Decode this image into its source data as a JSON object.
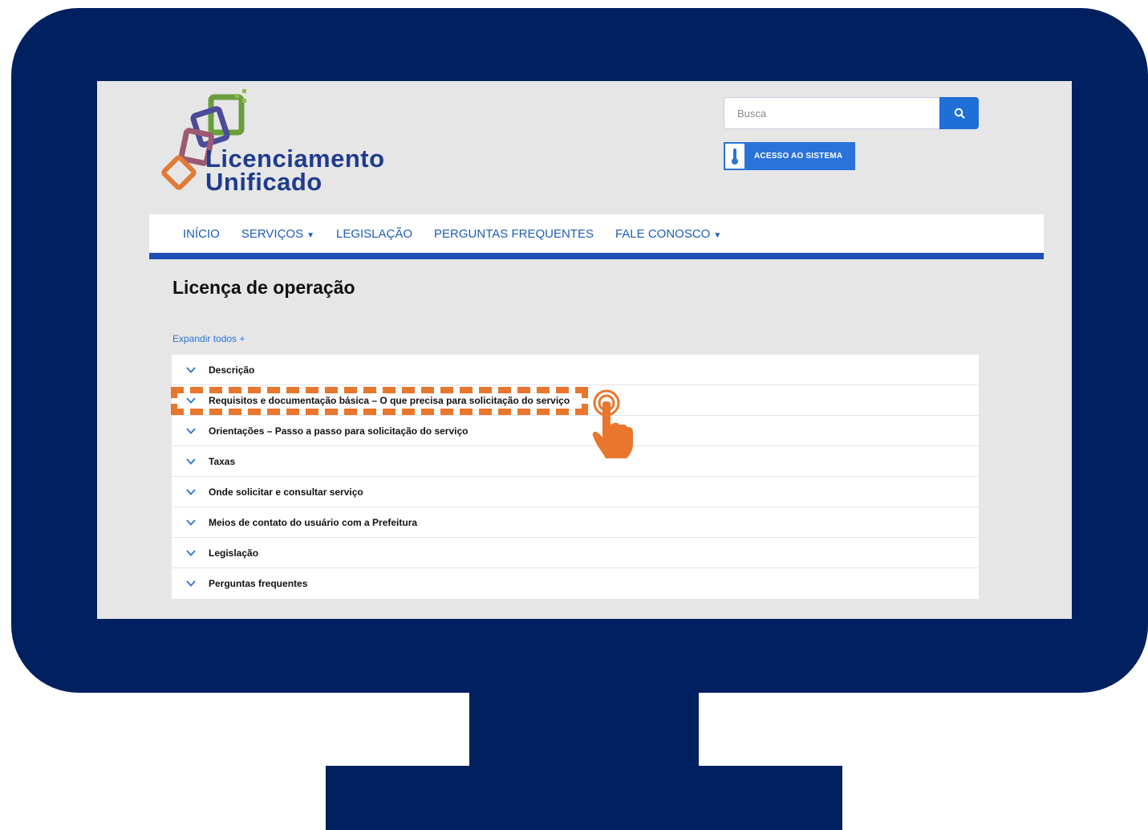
{
  "search": {
    "placeholder": "Busca"
  },
  "header": {
    "logo_line1": "Licenciamento",
    "logo_line2": "Unificado",
    "access_label": "ACESSO AO SISTEMA"
  },
  "nav": {
    "items": [
      {
        "label": "INÍCIO",
        "dropdown": false
      },
      {
        "label": "SERVIÇOS",
        "dropdown": true
      },
      {
        "label": "LEGISLAÇÃO",
        "dropdown": false
      },
      {
        "label": "PERGUNTAS FREQUENTES",
        "dropdown": false
      },
      {
        "label": "FALE CONOSCO",
        "dropdown": true
      }
    ]
  },
  "main": {
    "title": "Licença de operação",
    "expand_all": "Expandir todos +",
    "accordion": [
      "Descrição",
      "Requisitos e documentação básica – O que precisa para solicitação do serviço",
      "Orientações – Passo a passo para solicitação do serviço",
      "Taxas",
      "Onde solicitar e consultar serviço",
      "Meios de contato do usuário com a Prefeitura",
      "Legislação",
      "Perguntas frequentes"
    ]
  },
  "colors": {
    "monitor": "#002060",
    "nav_text": "#1d5bb8",
    "nav_border": "#1d4fb4",
    "accent": "#2a73d9",
    "highlight": "#e8762c"
  }
}
